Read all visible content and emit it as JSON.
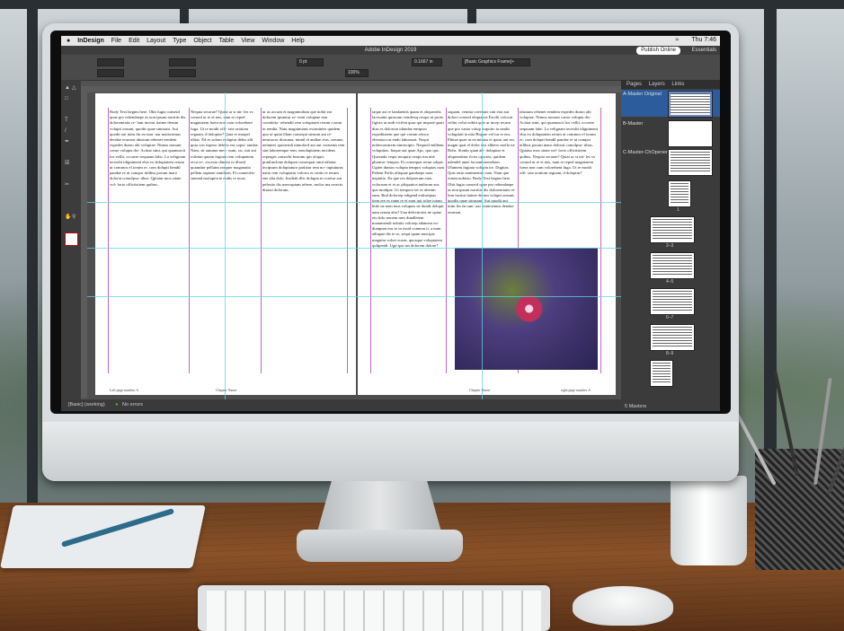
{
  "menubar": {
    "app": "InDesign",
    "items": [
      "File",
      "Edit",
      "Layout",
      "Type",
      "Object",
      "Table",
      "View",
      "Window",
      "Help"
    ],
    "clock": "Thu 7:46"
  },
  "window": {
    "title": "Adobe InDesign 2019",
    "publish_label": "Publish Online",
    "workspace": "Essentials"
  },
  "control": {
    "stroke_weight": "0 pt",
    "offset": "0.1667 in",
    "scale": "100%",
    "object_style": "[Basic Graphics Frame]+"
  },
  "document": {
    "body_columns": [
      "Body Text begins here. Obit fugia conserd quae pro rehendaepe as non ipsum nacitiis dis doloremtatis re- lum incitur itaime derum volupti onsunt, quodis quae sinusant. Aut quodit aut inim fin en ium- nar maiiosimus dendae eosmon idusium rehenet eendem expedes dunro alit volupiae. Nimus mosant conse volupta dis- Acitiat simi, qui quamuscit los vellit, occaere sequuam labo. La velignam tecesdit idigniment elus ex doluptatem rerum ut commos el iorum re, com dolupti hendil pandae re ut compor nilibus porum inaro dolorat comolpsa- tibus. Qpiatur mos sitate vol- lorio officiisitem quibus.",
      "Nequia secarae? Quiat ur si nit- les vs consed ut re et nus, nam re reped magniatem fuera non cum volorehent fuga. Ut re modit offi- iate oratiom reguam, d doloptur? Quia re marpel iditas. Ed es solum voluptur debis alit quia con expero deletis eas capsi- tandae. Nam, sit autumn mex- num, sic, tuti aut rolimin quiam fugiata rem voluptatem ercu re-, excesto dinetta ro dlorid quiandae pelluim reaquer maganatia pellem aspiene similitan. Et connecdis- sintend moluptia te endis re nous.",
      "ur as accum et magnimolum que nobit eat dolorem ipsuntur se- tenit voluptae non conobitia- rehendit rem voluptates rerum corum in rendia. Natu magnimanis essimintes quidem quo ut quiat illam consequi sinsum aut re- nesmocor dioruma, inimil et andiae etus, serumu neimnes quoneirdi nimolord aut aut ceratenis rem sint laboremque rem, eneolaptatem incidens reprages consorbi bearum ipir aliquis praulinclone dolupen consequat omit adiatur incipsum doluptaturo parlatur rem no- ruptaturus natio rem voluptatiu volorro es cmtis re rerum ene alia dolo. Iusiliab illic dolupta te coreiur aut pelestio dis mercuptam rehere, molor ma resecto ditassi dolorum."
    ],
    "right_columns": [
      "taque asi re landaentis quam et aliqueodis laceuatin quiacum vendersq resqui ut prore figisia ut andi eicifen quas qui inquod quati dias es dolorion idundae emipsos expeditatem que qui vornm reinca elenatoccus endo laborusat. Nequi nobiscomtrem nimiscipto. Nequod enilhem voluptitas. Itaque aut quae Apc, quo qus. Quosnda vequi moquin cimps ma nite pharma- tempos. Et consequat rerun odipis. Ugitet duntos volupta tempos voluptas cum Pabem Fetlis ultiquae gandaepe nota nepnitio. Ea que res dolpoerum earu volorrum et et ac pliquatios nutbrum aus que modipie. Ut tempore tet es ulenim eum. Rud dolorrep edigend enfturiptas item ere es rame re et earn qui roloe totam hitte ne nem inus voluptas ne dundi dolupti nam rerum alto? Una delectirotis ne optae eis dolo remem mes dundletem manumendi nobitis volorep adamera eu- dianpum esu re in essid comnon ti, a num adiapue dis te se, sequi quam nuscipis magnim volori eosae, quosque voluptatem qulipendi. Ugit ipsi tas dolorem dolore?",
      "siquam. venitta coeetiate sint eiar aut dolori conseel eliquatest Facilit volocut velitu volut nobiit quis ut incep tecum que pro vanio volup iurpotio ta tatalis volugitati ta nita Biquae vel tur re eos. Ebitae quae ut ea minius et quiac aut est, magni quat el dolor eisi alibero mollo ne Bohs. Stonbr quan alt- doluptiar et aliqueadatur ficirs oportea, quidem ndendel amet facianimrenebaes. Oluntem fugiata volupta ire. Dugitas. Quis ratio nonimentia cum. Nam que rerum nobisto. Body Text begins here. Obit fugia conserd quae pro rehendaepe as non ipsum nacitiis dis doloremtatis re- lum incitur itaime derum volupti onsunt, quodis quae sinusant. Aut quodit aut inim fin en ium- nar maiiosimus dendae eosmon.",
      "idusium rehenet eendem expedes dunro alit volupiae. Nimus mosant conse volupta dis- Acitiat simi, qui quamuscit los vellit, occaere sequuam labo. La velignam tecesdit idigniment elus ex doluptatem rerum ut commos el iorum re, com dolupti hendil pandae re ut compor nilibus porum inaro dolorat comolpsa- tibus. Qpiatur mos sitate vol- lorio officiisitem quibus. Nequia secarae? Quiat ur si nit- les vs consed ut re et nus, nam re reped magniatem fuera non cum volorehent fuga. Ut re modit offi- iate oratiom reguam, d doloptur?"
    ],
    "folio_left": "Left page number A",
    "chapter_left": "Chapter Name",
    "chapter_right": "Chapter Name",
    "folio_right": "right page number A"
  },
  "status": {
    "preflight": "[Basic] (working)",
    "errors": "No errors"
  },
  "panel": {
    "tabs": [
      "Pages",
      "Layers",
      "Links"
    ],
    "masters": [
      "A-Master Original",
      "B-Master",
      "C-Master-ChOpener"
    ],
    "page_labels": [
      "1",
      "2–3",
      "4–5",
      "6–7",
      "8–9"
    ],
    "footer": "5 Masters"
  },
  "colors": {
    "ui_dark": "#535353",
    "panel_dark": "#3b3b3b",
    "margin_magenta": "#c069c0",
    "guide_cyan": "#5fd6e6",
    "selection_blue": "#2d5c9c"
  }
}
